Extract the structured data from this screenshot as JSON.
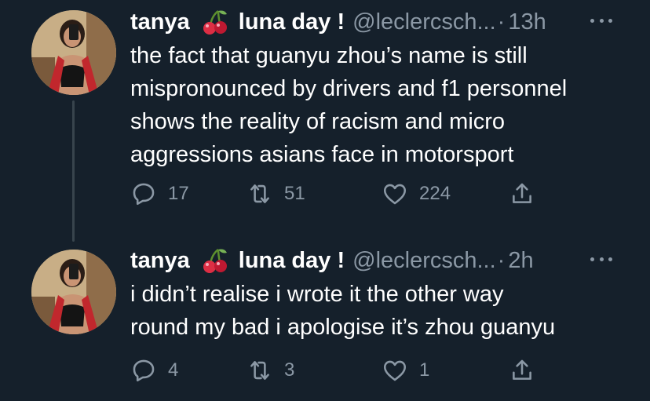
{
  "colors": {
    "background": "#15202b",
    "text": "#ffffff",
    "muted": "#8b98a5",
    "thread_line": "#38444d"
  },
  "tweets": [
    {
      "display_name": "tanya",
      "display_name_suffix": "luna day !",
      "emoji": "cherries-icon",
      "handle": "@leclercsch...",
      "separator": "·",
      "time": "13h",
      "text_lines": [
        "the fact that guanyu zhou’s name is still",
        "mispronounced by drivers and f1 personnel",
        "shows the reality of racism and micro",
        "aggressions asians face in motorsport"
      ],
      "replies": "17",
      "retweets": "51",
      "likes": "224"
    },
    {
      "display_name": "tanya",
      "display_name_suffix": "luna day !",
      "emoji": "cherries-icon",
      "handle": "@leclercsch...",
      "separator": "·",
      "time": "2h",
      "text_lines": [
        "i didn’t realise i wrote it the other way",
        "round my bad i apologise it’s zhou guanyu"
      ],
      "replies": "4",
      "retweets": "3",
      "likes": "1"
    }
  ]
}
